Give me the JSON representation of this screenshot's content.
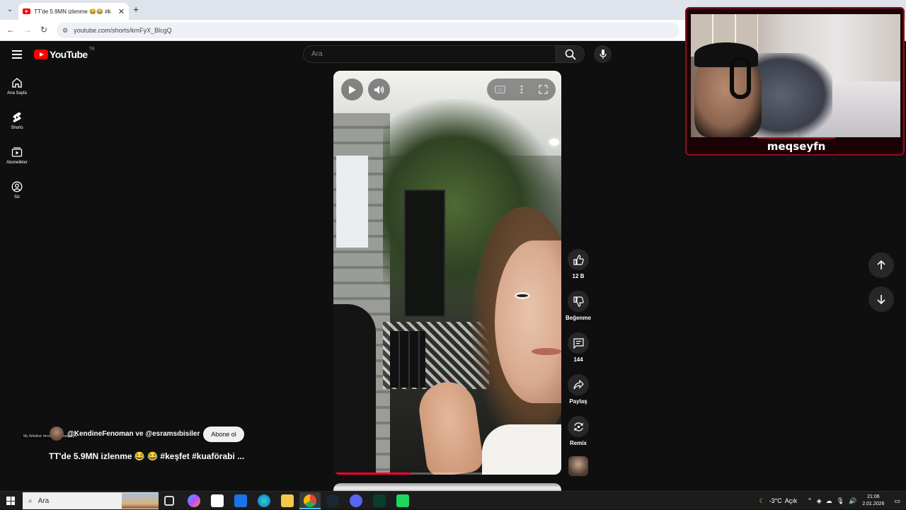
{
  "browser": {
    "tab_title": "TT'de 5.9MN izlenme 😂😂 #k",
    "url": "youtube.com/shorts/kmFyX_BlcgQ"
  },
  "youtube": {
    "logo_text": "YouTube",
    "country_code": "TR",
    "search_placeholder": "Ara",
    "sidebar": [
      {
        "label": "Ana Sayfa",
        "icon": "home-icon"
      },
      {
        "label": "Shorts",
        "icon": "shorts-icon"
      },
      {
        "label": "Abonelikler",
        "icon": "subscriptions-icon"
      },
      {
        "label": "Siz",
        "icon": "account-icon"
      }
    ],
    "short": {
      "channel": "@KendineFenoman ve @esramsıbisiler",
      "subscribe_label": "Abone ol",
      "title": "TT'de 5.9MN izlenme 😂 😂 #keşfet #kuaförabi ...",
      "progress": 0.34,
      "overlay_text": "My Wishlist: throne.com/meqseyfn"
    },
    "actions": [
      {
        "icon": "like-icon",
        "label": "12 B"
      },
      {
        "icon": "dislike-icon",
        "label": "Beğenme"
      },
      {
        "icon": "comment-icon",
        "label": "144"
      },
      {
        "icon": "share-icon",
        "label": "Paylaş"
      },
      {
        "icon": "remix-icon",
        "label": "Remix"
      }
    ]
  },
  "webcam": {
    "streamer_name": "meqseyfn"
  },
  "taskbar": {
    "search_placeholder": "Ara",
    "weather": "-3°C",
    "weather_desc": "Açık",
    "time": "21:06",
    "date": "2.01.2026"
  }
}
